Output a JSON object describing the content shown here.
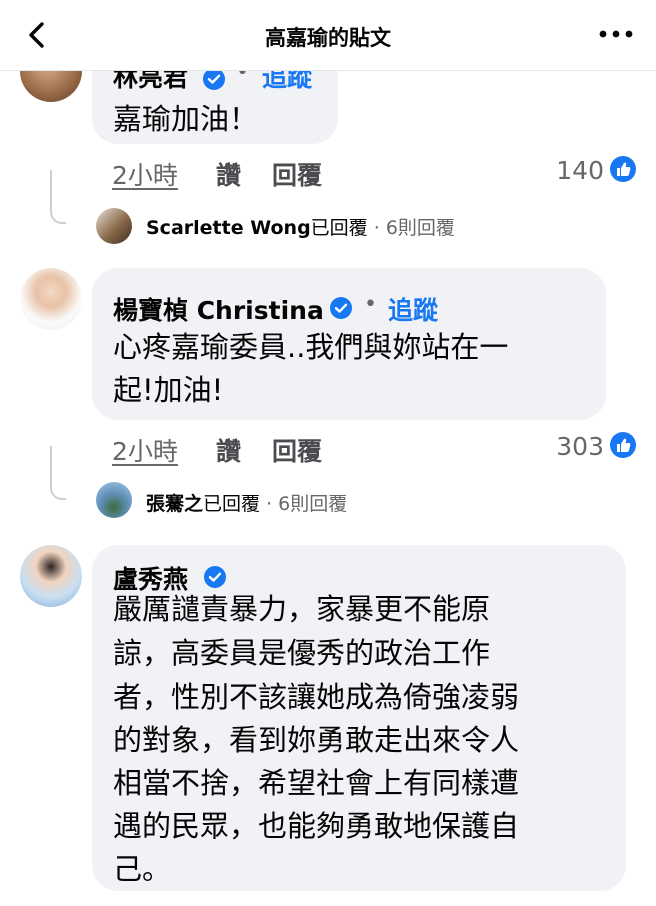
{
  "header": {
    "title": "高嘉瑜的貼文",
    "back_icon": "chevron-left-icon",
    "more_icon": "more-horizontal-icon"
  },
  "comments": [
    {
      "name": "林亮君",
      "follow": "追蹤",
      "dot": "•",
      "text": "嘉瑜加油！",
      "time": "2小時",
      "like": "讚",
      "reply": "回覆",
      "count": "140",
      "replies": {
        "name": "Scarlette Wong",
        "suffix": "已回覆",
        "sep": " · ",
        "count": "6則回覆"
      }
    },
    {
      "name": "楊寶楨 Christina",
      "follow": "追蹤",
      "dot": "•",
      "text_lines": [
        "心疼嘉瑜委員..我們與妳站在一",
        "起!加油!"
      ],
      "time": "2小時",
      "like": "讚",
      "reply": "回覆",
      "count": "303",
      "replies": {
        "name": "張騫之",
        "suffix": "已回覆",
        "sep": " · ",
        "count": "6則回覆"
      }
    },
    {
      "name": "盧秀燕",
      "text_lines": [
        "嚴厲譴責暴力，家暴更不能原",
        "諒，高委員是優秀的政治工作",
        "者，性別不該讓她成為倚強凌弱",
        "的對象，看到妳勇敢走出來令人",
        "相當不捨，希望社會上有同樣遭",
        "遇的民眾，也能夠勇敢地保護自",
        "己。"
      ]
    }
  ],
  "colors": {
    "accent": "#1877f2",
    "bubble": "#f0f2f5",
    "secondary_text": "#65676b"
  }
}
